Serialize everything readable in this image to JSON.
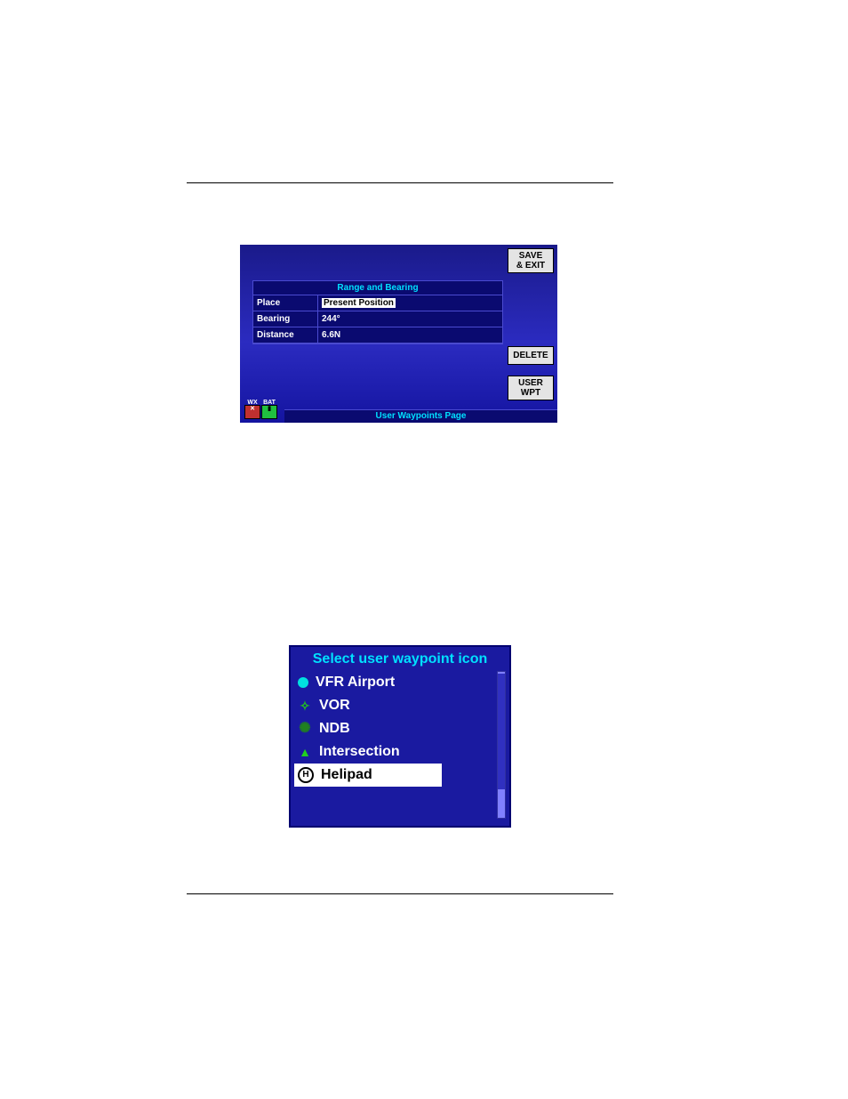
{
  "shot1": {
    "range_bearing_title": "Range and Bearing",
    "rows": {
      "place_key": "Place",
      "place_val": "Present Position",
      "bearing_key": "Bearing",
      "bearing_val": "244°",
      "distance_key": "Distance",
      "distance_val": "6.6N"
    },
    "buttons": {
      "save": "SAVE\n& EXIT",
      "delete": "DELETE",
      "user": "USER\nWPT"
    },
    "status": {
      "wx_label": "WX",
      "bat_label": "BAT"
    },
    "page_footer": "User Waypoints Page"
  },
  "shot2": {
    "title": "Select user waypoint icon",
    "items": [
      {
        "label": "VFR Airport",
        "icon": "circle-cyan",
        "selected": false
      },
      {
        "label": "VOR",
        "icon": "vor",
        "selected": false
      },
      {
        "label": "NDB",
        "icon": "ndb",
        "selected": false
      },
      {
        "label": "Intersection",
        "icon": "tri",
        "selected": false
      },
      {
        "label": "Helipad",
        "icon": "heli",
        "selected": true
      }
    ]
  }
}
